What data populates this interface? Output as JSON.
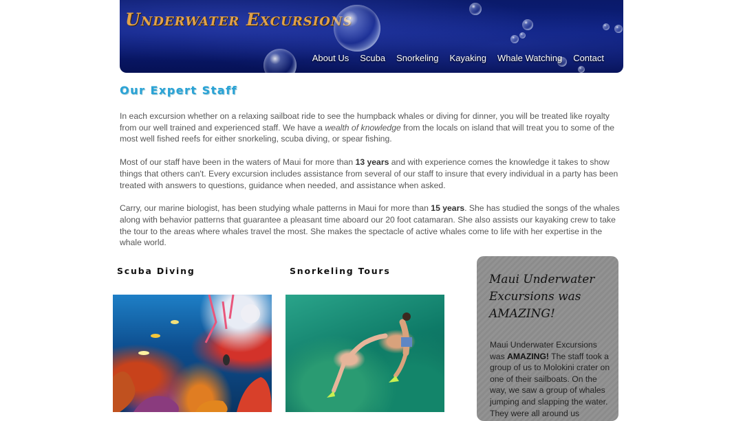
{
  "header": {
    "brand": "Underwater Excursions",
    "nav": [
      "About Us",
      "Scuba",
      "Snorkeling",
      "Kayaking",
      "Whale Watching",
      "Contact"
    ]
  },
  "main": {
    "title": "Our Expert Staff",
    "p1": {
      "a": "In each excursion whether on a relaxing sailboat ride to see the humpback whales or diving for dinner, you will be treated like royalty from our well trained and experienced staff. We have a ",
      "em": "wealth of knowledge",
      "b": " from the locals on island that will treat you to some of the most well fished reefs for either snorkeling, scuba diving, or spear fishing."
    },
    "p2": {
      "a": "Most of our staff have been in the waters of Maui for more than ",
      "strong": "13 years",
      "b": " and with experience comes the knowledge it takes to show things that others can't. Every excursion includes assistance from several of our staff to insure that every individual in a party has been treated with answers to questions, guidance when needed, and assistance when asked."
    },
    "p3": {
      "a": "Carry, our marine biologist, has been studying whale patterns in Maui for more than ",
      "strong": "15 years",
      "b": ". She has studied the songs of the whales along with behavior patterns that guarantee a pleasant time aboard our 20 foot catamaran. She also assists our kayaking crew to take the tour to the areas where whales travel the most. She makes the spectacle of active whales come to life with her expertise in the whale world."
    }
  },
  "features": {
    "scuba_title": "Scuba Diving",
    "snorkel_title": "Snorkeling Tours"
  },
  "testimonial": {
    "heading": "Maui Underwater Excursions was AMAZING!",
    "body_a": "Maui Underwater Excursions was ",
    "body_strong": "AMAZING!",
    "body_b": " The staff took a group of us to Molokini crater on one of their sailboats. On the way, we saw a group of whales jumping and slapping the water. They were all around us"
  },
  "colors": {
    "title_blue": "#2aa3d6",
    "brand_orange": "#e0a24a",
    "header_navy": "#0b1e7c",
    "testimonial_gray": "#8f8f8f"
  }
}
